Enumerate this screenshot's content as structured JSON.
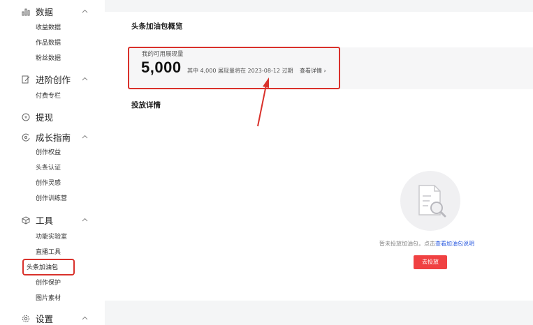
{
  "sidebar": {
    "sections": [
      {
        "title": "数据",
        "icon": "bar-chart-icon",
        "items": [
          "收益数据",
          "作品数据",
          "粉丝数据"
        ]
      },
      {
        "title": "进阶创作",
        "icon": "edit-icon",
        "items": [
          "付费专栏"
        ]
      },
      {
        "title": "提现",
        "icon": "yen-icon",
        "items": []
      },
      {
        "title": "成长指南",
        "icon": "compass-icon",
        "items": [
          "创作权益",
          "头条认证",
          "创作灵感",
          "创作训练营"
        ]
      },
      {
        "title": "工具",
        "icon": "cube-icon",
        "items": [
          "功能实验室",
          "直播工具",
          "头条加油包",
          "创作保护",
          "图片素材"
        ]
      },
      {
        "title": "设置",
        "icon": "gear-icon",
        "items": []
      }
    ]
  },
  "main": {
    "title": "头条加油包概览",
    "stat": {
      "label": "我的可用展现量",
      "value": "5,000",
      "note": "其中 4,000 展现量将在 2023-08-12 过期",
      "link": "查看详情 ›"
    },
    "section_title": "投放详情",
    "empty": {
      "text": "暂未投放加油包，点击",
      "link": "查看加油包说明",
      "button": "去投放"
    }
  },
  "colors": {
    "accent_red": "#f04142",
    "highlight_red": "#d9312b",
    "link_blue": "#2f5ee0"
  }
}
